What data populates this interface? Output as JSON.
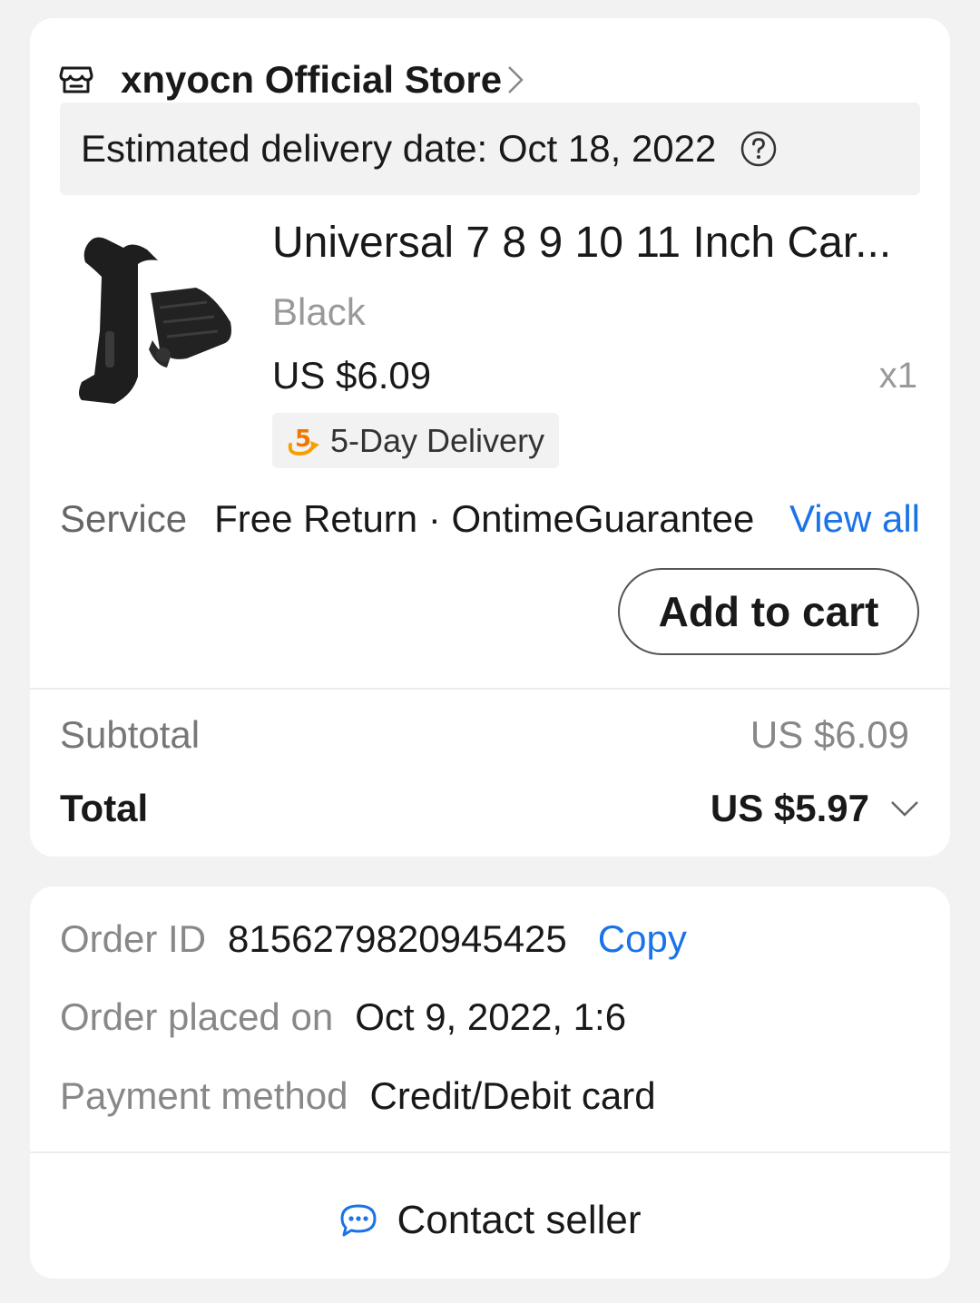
{
  "order_card": {
    "store": {
      "name": "xnyocn Official Store",
      "icon": "store-icon"
    },
    "delivery": {
      "text": "Estimated delivery date: Oct 18, 2022",
      "icon": "question-circle-icon"
    },
    "product": {
      "title": "Universal 7 8 9 10 11 Inch Car...",
      "variant": "Black",
      "price": "US $6.09",
      "quantity": "x1",
      "badge": {
        "icon": "five-day-delivery-icon",
        "text": "5-Day Delivery"
      }
    },
    "service": {
      "label": "Service",
      "value": "Free Return · OntimeGuarantee",
      "view_all": "View all"
    },
    "add_to_cart": "Add to cart",
    "subtotal": {
      "label": "Subtotal",
      "value": "US $6.09"
    },
    "total": {
      "label": "Total",
      "value": "US $5.97"
    }
  },
  "info_card": {
    "order_id": {
      "label": "Order ID",
      "value": "8156279820945425",
      "copy": "Copy"
    },
    "placed_on": {
      "label": "Order placed on",
      "value": "Oct 9, 2022, 1:6"
    },
    "payment": {
      "label": "Payment method",
      "value": "Credit/Debit card"
    },
    "contact": {
      "label": "Contact seller",
      "icon": "chat-bubble-icon"
    }
  },
  "colors": {
    "link": "#1a73e8",
    "background": "#f2f2f2",
    "badge_accent": "#f5a000"
  }
}
